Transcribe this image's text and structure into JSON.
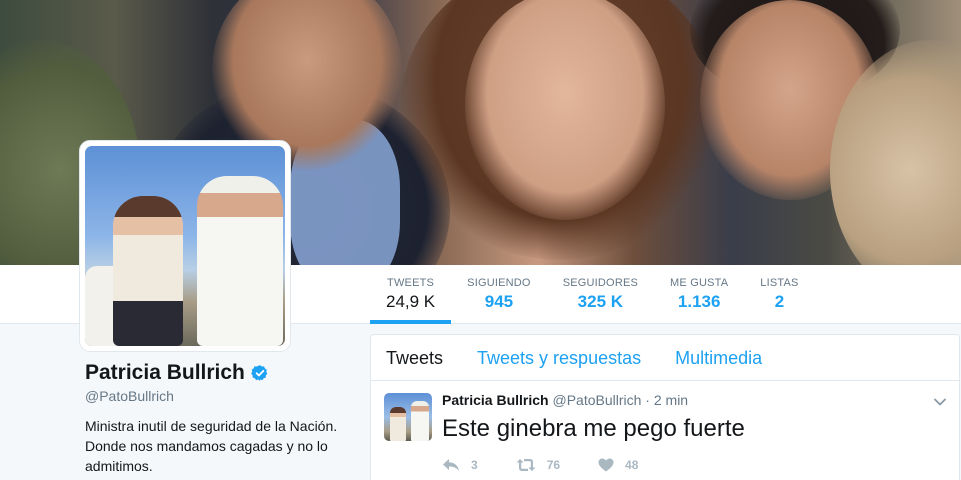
{
  "profile": {
    "name": "Patricia Bullrich",
    "handle": "@PatoBullrich",
    "bio": "Ministra inutil de seguridad de la Nación. Donde nos mandamos cagadas y no lo admitimos.",
    "verified": true
  },
  "stats": [
    {
      "label": "TWEETS",
      "value": "24,9 K"
    },
    {
      "label": "SIGUIENDO",
      "value": "945"
    },
    {
      "label": "SEGUIDORES",
      "value": "325 K"
    },
    {
      "label": "ME GUSTA",
      "value": "1.136"
    },
    {
      "label": "LISTAS",
      "value": "2"
    }
  ],
  "tabs": [
    {
      "label": "Tweets"
    },
    {
      "label": "Tweets y respuestas"
    },
    {
      "label": "Multimedia"
    }
  ],
  "tweet": {
    "name": "Patricia Bullrich",
    "handle": "@PatoBullrich",
    "separator": "·",
    "time": "2 min",
    "text": "Este ginebra me pego fuerte",
    "replies": "3",
    "retweets": "76",
    "likes": "48"
  },
  "colors": {
    "accent": "#1da1f2",
    "text": "#14171a",
    "muted": "#657786",
    "action": "#aab8c2"
  },
  "icons": [
    "verified-badge-icon",
    "caret-down-icon",
    "reply-icon",
    "retweet-icon",
    "heart-icon"
  ]
}
